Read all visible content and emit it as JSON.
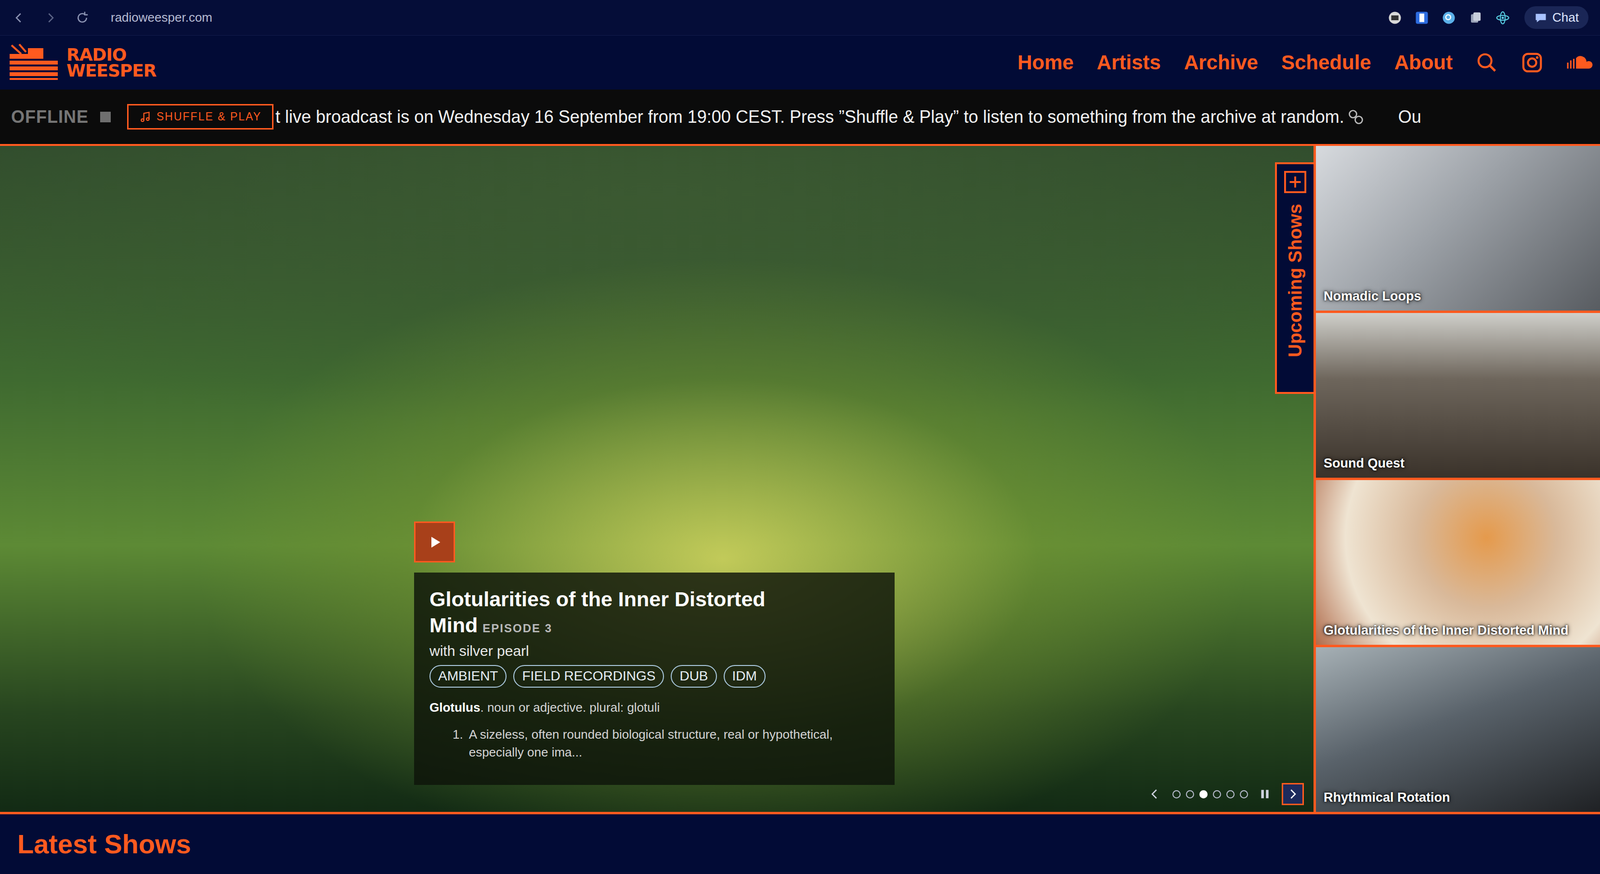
{
  "browser": {
    "url": "radioweesper.com",
    "chat": "Chat"
  },
  "logo": {
    "lines": [
      "RADIO",
      "WEESPER"
    ]
  },
  "nav": [
    {
      "label": "Home"
    },
    {
      "label": "Artists"
    },
    {
      "label": "Archive"
    },
    {
      "label": "Schedule"
    },
    {
      "label": "About"
    }
  ],
  "ticker": {
    "status": "OFFLINE",
    "live": false,
    "button": "SHUFFLE & PLAY",
    "message": "t live broadcast is on Wednesday 16 September from 19:00 CEST. Press ”Shuffle & Play” to listen to something from the archive at random.",
    "next_message": "Ou"
  },
  "feature": {
    "title": "Glotularities of the Inner Distorted Mind",
    "episode": "EPISODE 3",
    "artist": "with silver pearl",
    "tags": [
      "AMBIENT",
      "FIELD RECORDINGS",
      "DUB",
      "IDM"
    ],
    "definition": {
      "term": "Glotulus",
      "rest": ". noun or adjective. plural: glotuli"
    },
    "senses": [
      {
        "number": "1.",
        "text": "A sizeless, often rounded biological structure, real or hypothetical, especially one ima..."
      }
    ]
  },
  "carousel": {
    "playing": true,
    "slides": [
      {
        "selected": false
      },
      {
        "selected": false
      },
      {
        "selected": true
      },
      {
        "selected": false
      },
      {
        "selected": false
      },
      {
        "selected": false
      }
    ]
  },
  "upcoming": {
    "title": "Upcoming Shows",
    "shows": [
      {
        "name": "Nomadic Loops"
      },
      {
        "name": "Sound Quest"
      },
      {
        "name": "Glotularities of the Inner Distorted Mind"
      },
      {
        "name": "Rhythmical Rotation"
      }
    ]
  },
  "latest": {
    "title": "Latest Shows"
  }
}
